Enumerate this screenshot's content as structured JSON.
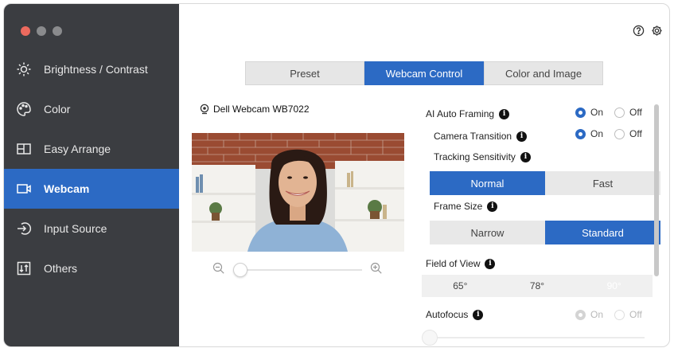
{
  "sidebar": {
    "items": [
      {
        "label": "Brightness / Contrast",
        "icon": "brightness-icon"
      },
      {
        "label": "Color",
        "icon": "palette-icon"
      },
      {
        "label": "Easy Arrange",
        "icon": "layout-icon"
      },
      {
        "label": "Webcam",
        "icon": "webcam-icon",
        "active": true
      },
      {
        "label": "Input Source",
        "icon": "input-icon"
      },
      {
        "label": "Others",
        "icon": "others-icon"
      }
    ]
  },
  "tabs": [
    {
      "label": "Preset"
    },
    {
      "label": "Webcam Control",
      "active": true
    },
    {
      "label": "Color and Image"
    }
  ],
  "camera": {
    "name": "Dell Webcam WB7022"
  },
  "settings": {
    "ai_auto_framing": {
      "label": "AI Auto Framing",
      "on": "On",
      "off": "Off",
      "value": "On"
    },
    "camera_transition": {
      "label": "Camera Transition",
      "on": "On",
      "off": "Off",
      "value": "On"
    },
    "tracking_sensitivity": {
      "label": "Tracking Sensitivity",
      "options": [
        "Normal",
        "Fast"
      ],
      "selected": "Normal"
    },
    "frame_size": {
      "label": "Frame Size",
      "options": [
        "Narrow",
        "Standard"
      ],
      "selected": "Standard"
    },
    "field_of_view": {
      "label": "Field of View",
      "options": [
        "65°",
        "78°",
        "90°"
      ],
      "selected": "90°"
    },
    "autofocus": {
      "label": "Autofocus",
      "on": "On",
      "off": "Off",
      "value": "On",
      "disabled": true
    }
  },
  "colors": {
    "accent": "#2c6ac4",
    "sidebar_bg": "#3b3d41"
  }
}
